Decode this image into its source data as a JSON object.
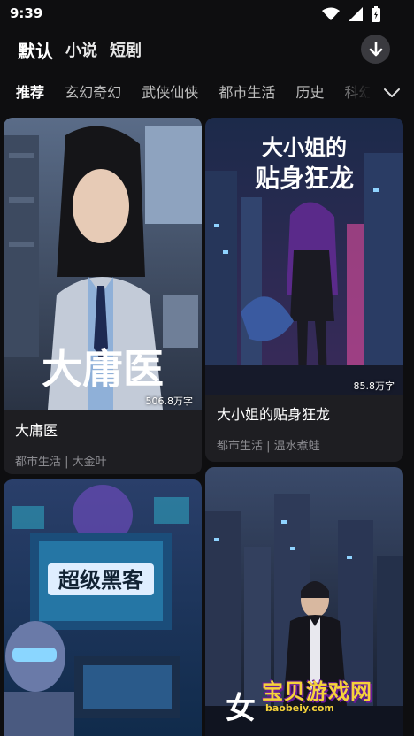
{
  "status_bar": {
    "time": "9:39"
  },
  "top_tabs": [
    {
      "label": "默认",
      "active": true
    },
    {
      "label": "小说",
      "active": false
    },
    {
      "label": "短剧",
      "active": false
    }
  ],
  "categories": [
    {
      "label": "推荐",
      "active": true
    },
    {
      "label": "玄幻奇幻",
      "active": false
    },
    {
      "label": "武侠仙侠",
      "active": false
    },
    {
      "label": "都市生活",
      "active": false
    },
    {
      "label": "历史",
      "active": false
    },
    {
      "label": "科幻",
      "active": false
    }
  ],
  "books": [
    {
      "title": "大庸医",
      "cover_text": "大庸医",
      "word_count": "506.8万字",
      "genre": "都市生活",
      "author": "大金叶",
      "meta": "都市生活 | 大金叶"
    },
    {
      "title": "大小姐的贴身狂龙",
      "cover_text": "大小姐的贴身狂龙",
      "cover_line1": "大小姐的",
      "cover_line2": "贴身狂龙",
      "word_count": "85.8万字",
      "genre": "都市生活",
      "author": "温水煮蛙",
      "meta": "都市生活 | 温水煮蛙"
    },
    {
      "cover_text": "超级黑客"
    },
    {
      "cover_text": "女"
    }
  ],
  "watermark": {
    "text": "宝贝游戏网",
    "url": "baobeiy.com"
  }
}
